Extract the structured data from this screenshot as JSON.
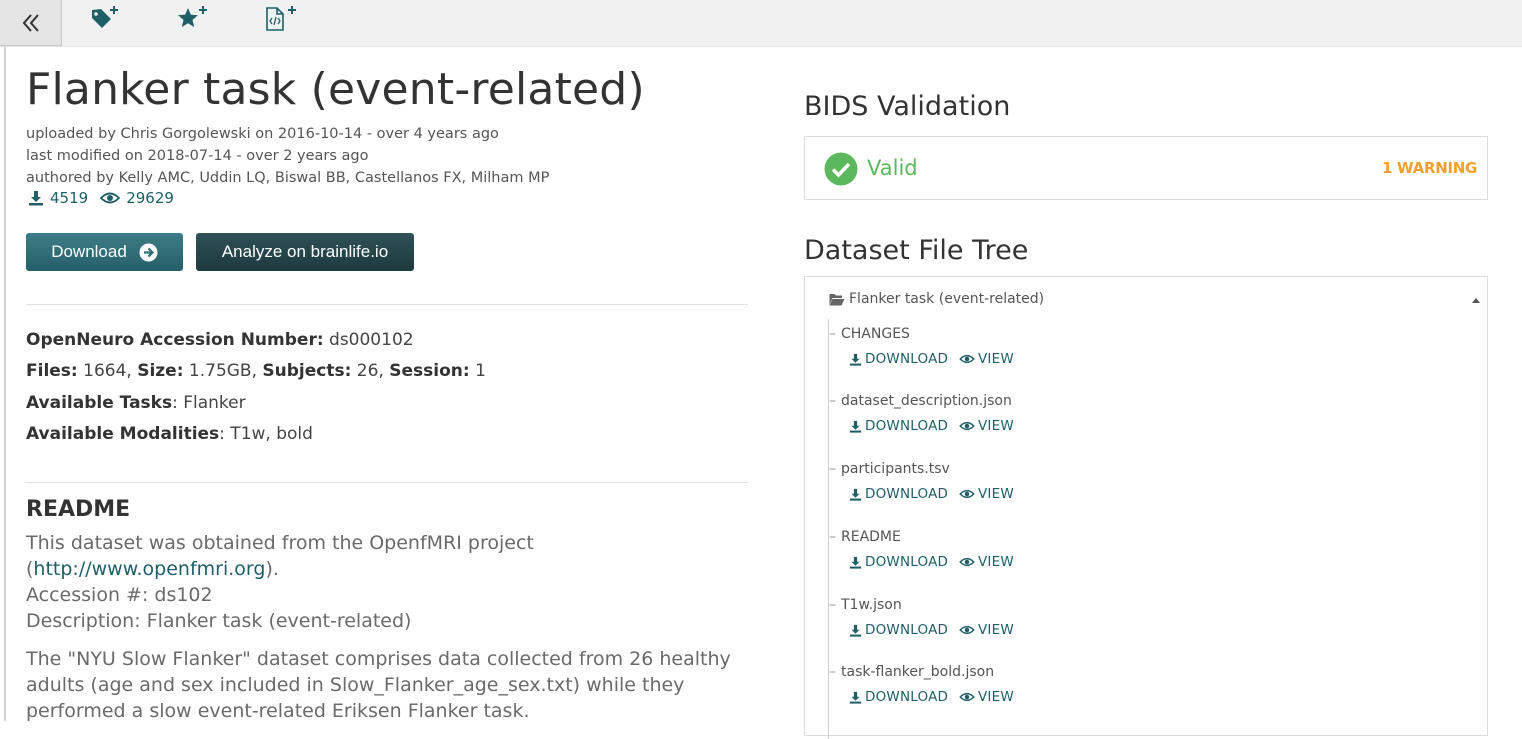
{
  "dataset": {
    "title": "Flanker task (event-related)",
    "uploaded": "uploaded by Chris Gorgolewski on 2016-10-14 - over 4 years ago",
    "modified": "last modified on 2018-07-14 - over 2 years ago",
    "authored": "authored by Kelly AMC, Uddin LQ, Biswal BB, Castellanos FX, Milham MP",
    "downloads": "4519",
    "views": "29629"
  },
  "buttons": {
    "download": "Download",
    "analyze": "Analyze on brainlife.io"
  },
  "info": {
    "accession_label": "OpenNeuro Accession Number:",
    "accession_value": " ds000102",
    "files_label": "Files:",
    "files_value": " 1664, ",
    "size_label": "Size:",
    "size_value": " 1.75GB, ",
    "subjects_label": "Subjects:",
    "subjects_value": " 26, ",
    "session_label": "Session:",
    "session_value": " 1",
    "tasks_label": "Available Tasks",
    "tasks_value": ": Flanker",
    "modalities_label": "Available Modalities",
    "modalities_value": ": T1w, bold"
  },
  "readme": {
    "title": "README",
    "line1": "This dataset was obtained from the OpenfMRI project",
    "line2_open": "(",
    "line2_link": "http://www.openfmri.org",
    "line2_close": ").",
    "line3": "Accession #: ds102",
    "line4": "Description: Flanker task (event-related)",
    "line5": "The \"NYU Slow Flanker\" dataset comprises data collected from 26 healthy",
    "line6": "adults (age and sex included in Slow_Flanker_age_sex.txt) while they",
    "line7": "performed a slow event-related Eriksen Flanker task."
  },
  "validation": {
    "title": "BIDS Validation",
    "status": "Valid",
    "warnings": "1 WARNING"
  },
  "file_tree": {
    "title": "Dataset File Tree",
    "root": "Flanker task (event-related)",
    "download_label": "DOWNLOAD",
    "view_label": "VIEW",
    "files": [
      {
        "name": "CHANGES"
      },
      {
        "name": "dataset_description.json"
      },
      {
        "name": "participants.tsv"
      },
      {
        "name": "README"
      },
      {
        "name": "T1w.json"
      },
      {
        "name": "task-flanker_bold.json"
      }
    ]
  },
  "colors": {
    "accent": "#1f5f68",
    "valid": "#5cb85c",
    "warning": "#f0a030"
  }
}
